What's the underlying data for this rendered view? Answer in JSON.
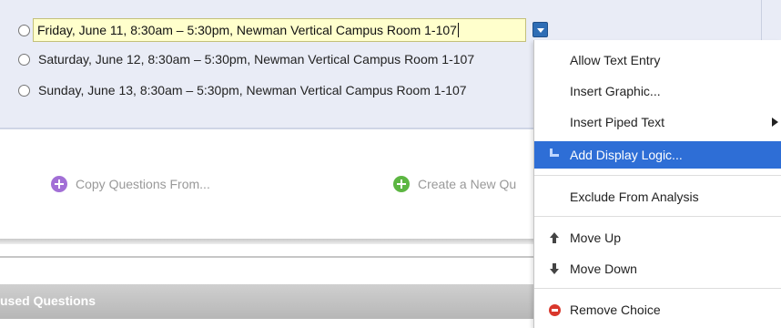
{
  "question": {
    "choices": [
      {
        "label": "Friday, June 11, 8:30am – 5:30pm, Newman Vertical Campus Room 1-107",
        "editing": true
      },
      {
        "label": "Saturday, June 12, 8:30am – 5:30pm, Newman Vertical Campus Room 1-107",
        "editing": false
      },
      {
        "label": "Sunday, June 13, 8:30am – 5:30pm, Newman Vertical Campus Room 1-107",
        "editing": false
      }
    ]
  },
  "actions": {
    "copy_questions": "Copy Questions From...",
    "create_question": "Create a New Qu"
  },
  "unused_section": {
    "title": "used Questions"
  },
  "context_menu": {
    "items": [
      {
        "label": "Allow Text Entry",
        "icon": ""
      },
      {
        "label": "Insert Graphic...",
        "icon": ""
      },
      {
        "label": "Insert Piped Text",
        "icon": "",
        "submenu": true
      },
      {
        "label": "Add Display Logic...",
        "icon": "display-logic-icon",
        "highlighted": true
      },
      {
        "label": "Exclude From Analysis",
        "icon": ""
      },
      {
        "label": "Move Up",
        "icon": "arrow-up-icon"
      },
      {
        "label": "Move Down",
        "icon": "arrow-down-icon"
      },
      {
        "label": "Remove Choice",
        "icon": "remove-circle-icon"
      }
    ]
  },
  "colors": {
    "panel_bg": "#e9ecf6",
    "edit_field_bg": "#ffffcc",
    "menu_highlight": "#2e6ed6",
    "remove_red": "#d9372c",
    "add_purple": "#a26fd6",
    "add_green": "#5cb642"
  }
}
